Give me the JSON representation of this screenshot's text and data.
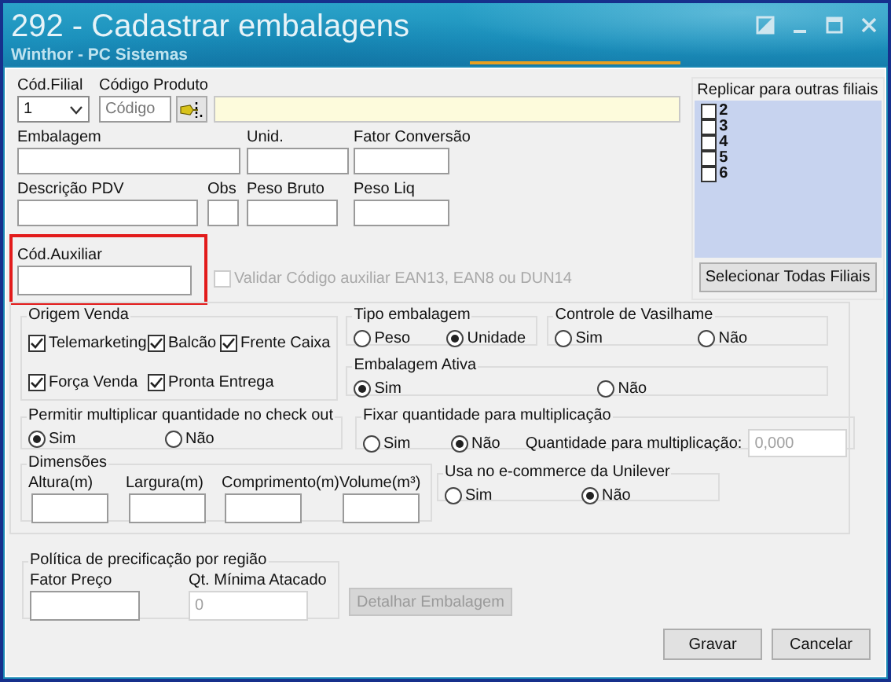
{
  "window": {
    "title": "292 - Cadastrar embalagens",
    "subtitle": "Winthor - PC Sistemas"
  },
  "rows": [
    [
      {
        "kind": "select",
        "label": "Cód.Filial",
        "value": "1"
      },
      {
        "kind": "lookup",
        "label": "Código Produto",
        "placeholder": "Código"
      },
      {
        "kind": "description"
      }
    ],
    [
      {
        "kind": "text",
        "label": "Embalagem"
      },
      {
        "kind": "text",
        "label": "Unid."
      },
      {
        "kind": "text",
        "label": "Fator Conversão"
      }
    ],
    [
      {
        "kind": "text",
        "label": "Descrição PDV"
      },
      {
        "kind": "text",
        "label": "Obs"
      },
      {
        "kind": "text",
        "label": "Peso Bruto"
      },
      {
        "kind": "text",
        "label": "Peso Liq"
      }
    ]
  ],
  "aux_code": {
    "label": "Cód.Auxiliar",
    "highlighted": true
  },
  "validate": {
    "label": "Validar Código auxiliar EAN13, EAN8 ou DUN14",
    "checked": false,
    "disabled": true
  },
  "replicate": {
    "title": "Replicar para outras filiais",
    "branches": [
      {
        "label": "2",
        "checked": false
      },
      {
        "label": "3",
        "checked": false
      },
      {
        "label": "4",
        "checked": false
      },
      {
        "label": "5",
        "checked": false
      },
      {
        "label": "6",
        "checked": false
      }
    ],
    "button": "Selecionar Todas Filiais"
  },
  "origem_venda": {
    "title": "Origem Venda",
    "options": [
      {
        "label": "Telemarketing",
        "checked": true
      },
      {
        "label": "Balcão",
        "checked": true
      },
      {
        "label": "Frente Caixa",
        "checked": true
      },
      {
        "label": "Força Venda",
        "checked": true
      },
      {
        "label": "Pronta Entrega",
        "checked": true
      }
    ]
  },
  "tipo_embalagem": {
    "title": "Tipo embalagem",
    "options": [
      {
        "label": "Peso",
        "selected": false
      },
      {
        "label": "Unidade",
        "selected": true
      }
    ]
  },
  "controle_vasilhame": {
    "title": "Controle de Vasilhame",
    "options": [
      {
        "label": "Sim",
        "selected": false
      },
      {
        "label": "Não",
        "selected": false
      }
    ]
  },
  "embalagem_ativa": {
    "title": "Embalagem Ativa",
    "options": [
      {
        "label": "Sim",
        "selected": true
      },
      {
        "label": "Não",
        "selected": false
      }
    ]
  },
  "multiplicar_checkout": {
    "title": "Permitir multiplicar quantidade no check out",
    "options": [
      {
        "label": "Sim",
        "selected": true
      },
      {
        "label": "Não",
        "selected": false
      }
    ]
  },
  "fixar_quantidade": {
    "title": "Fixar quantidade para multiplicação",
    "options": [
      {
        "label": "Sim",
        "selected": false
      },
      {
        "label": "Não",
        "selected": true
      }
    ],
    "quantity": {
      "label": "Quantidade para multiplicação:",
      "value": "0,000",
      "disabled": true
    }
  },
  "dimensoes": {
    "title": "Dimensões",
    "fields": [
      "Altura(m)",
      "Largura(m)",
      "Comprimento(m)",
      "Volume(m³)"
    ]
  },
  "ecommerce": {
    "title": "Usa no e-commerce da Unilever",
    "options": [
      {
        "label": "Sim",
        "selected": false
      },
      {
        "label": "Não",
        "selected": true
      }
    ]
  },
  "politica": {
    "title": "Política de precificação por região",
    "fields": [
      {
        "label": "Fator Preço",
        "disabled": false
      },
      {
        "label": "Qt. Mínima Atacado",
        "value": "0",
        "disabled": true
      }
    ]
  },
  "detail_button": {
    "label": "Detalhar Embalagem",
    "disabled": true
  },
  "buttons": [
    "Gravar",
    "Cancelar"
  ]
}
